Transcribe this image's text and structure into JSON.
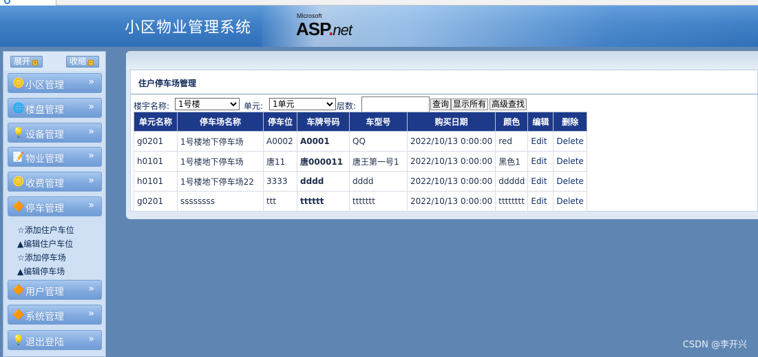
{
  "header": {
    "system_title": "小区物业管理系统",
    "logo_microsoft": "Microsoft",
    "logo_asp": "ASP",
    "logo_net": "net"
  },
  "sidebar": {
    "expand_label": "展开",
    "collapse_label": "收缩",
    "items": [
      {
        "label": "小区管理",
        "icon": "coin-icon"
      },
      {
        "label": "楼盘管理",
        "icon": "globe-icon"
      },
      {
        "label": "设备管理",
        "icon": "lightbulb-icon"
      },
      {
        "label": "物业管理",
        "icon": "edit-doc-icon"
      },
      {
        "label": "收费管理",
        "icon": "coin-icon"
      },
      {
        "label": "停车管理",
        "icon": "shapes-icon"
      },
      {
        "label": "用户管理",
        "icon": "shapes-icon"
      },
      {
        "label": "系统管理",
        "icon": "shapes-icon"
      },
      {
        "label": "退出登陆",
        "icon": "lightbulb-icon"
      }
    ],
    "submenu": [
      "☆添加住户车位",
      "▲编辑住户车位",
      "☆添加停车场",
      "▲编辑停车场"
    ]
  },
  "main": {
    "section_title": "住户停车场管理",
    "filter": {
      "building_label": "楼宇名称:",
      "building_value": "1号楼",
      "unit_label": "单元:",
      "unit_value": "1单元",
      "floor_label": "层数:",
      "floor_value": "",
      "query_button": "查询",
      "show_all_button": "显示所有",
      "advanced_button": "高级查找"
    },
    "table": {
      "headers": [
        "单元名称",
        "停车场名称",
        "停车位",
        "车牌号码",
        "车型号",
        "购买日期",
        "颜色",
        "编辑",
        "删除"
      ],
      "rows": [
        [
          "g0201",
          "1号楼地下停车场",
          "A0002",
          "A0001",
          "QQ",
          "2022/10/13 0:00:00",
          "red",
          "Edit",
          "Delete"
        ],
        [
          "h0101",
          "1号楼地下停车场",
          "唐11",
          "唐000011",
          "唐王第一号1",
          "2022/10/13 0:00:00",
          "黑色1",
          "Edit",
          "Delete"
        ],
        [
          "h0101",
          "1号楼地下停车场22",
          "3333",
          "dddd",
          "dddd",
          "2022/10/13 0:00:00",
          "ddddd",
          "Edit",
          "Delete"
        ],
        [
          "g0201",
          "ssssssss",
          "ttt",
          "tttttt",
          "ttttttt",
          "2022/10/13 0:00:00",
          "tttttttt",
          "Edit",
          "Delete"
        ]
      ]
    }
  },
  "watermark": "CSDN @李开兴",
  "colors": {
    "header": "#3f7fc6",
    "sidebar": "#cfe0f4",
    "table_header": "#1d3a8a",
    "background": "#5f86b2"
  }
}
